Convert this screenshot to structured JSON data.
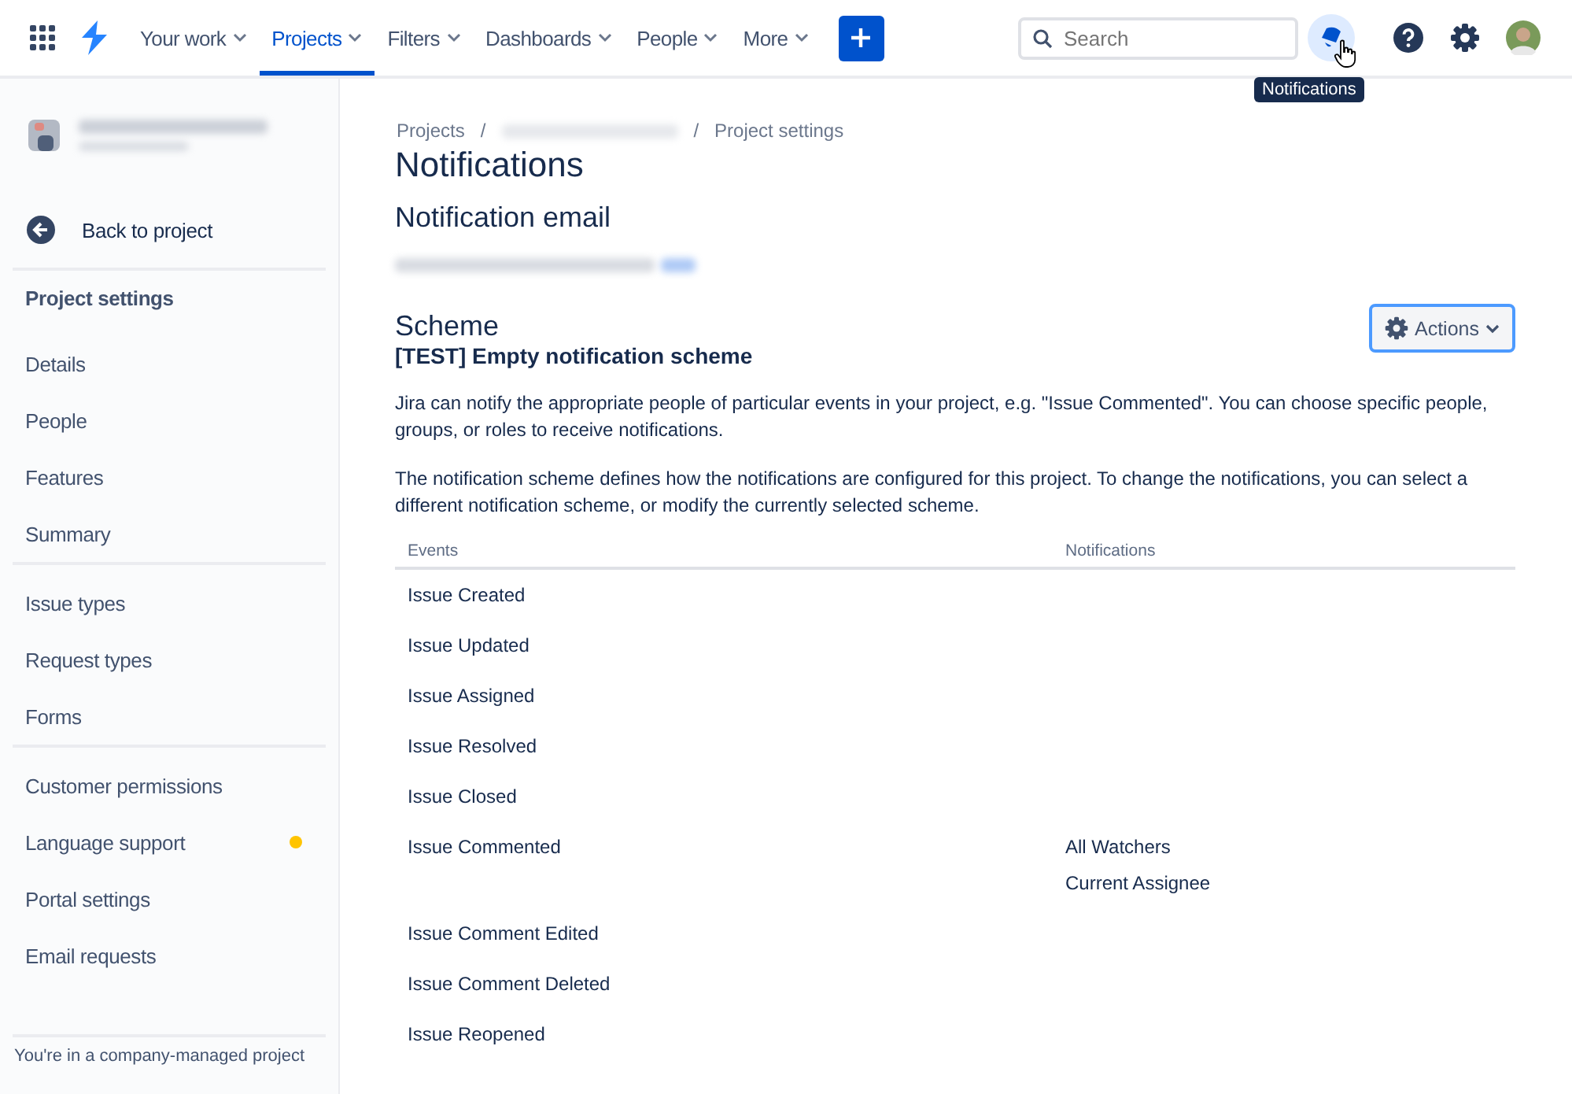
{
  "topbar": {
    "nav": [
      {
        "label": "Your work",
        "selected": false
      },
      {
        "label": "Projects",
        "selected": true
      },
      {
        "label": "Filters",
        "selected": false
      },
      {
        "label": "Dashboards",
        "selected": false
      },
      {
        "label": "People",
        "selected": false
      },
      {
        "label": "More",
        "selected": false
      }
    ],
    "search": {
      "placeholder": "Search"
    },
    "tooltip": "Notifications"
  },
  "sidebar": {
    "back": "Back to project",
    "heading": "Project settings",
    "groups": [
      [
        {
          "label": "Details"
        },
        {
          "label": "People"
        },
        {
          "label": "Features"
        },
        {
          "label": "Summary"
        }
      ],
      [
        {
          "label": "Issue types"
        },
        {
          "label": "Request types"
        },
        {
          "label": "Forms"
        }
      ],
      [
        {
          "label": "Customer permissions"
        },
        {
          "label": "Language support",
          "color": "#ffc400"
        },
        {
          "label": "Portal settings"
        },
        {
          "label": "Email requests"
        }
      ]
    ],
    "footer": "You're in a company-managed project"
  },
  "breadcrumbs": {
    "items": [
      "Projects",
      "Project settings"
    ],
    "separators": [
      "/",
      "/"
    ]
  },
  "title": "Notifications",
  "email_heading": "Notification email",
  "scheme_heading": "Scheme",
  "actions_button": "Actions",
  "scheme_name": "[TEST] Empty notification scheme",
  "paragraphs": [
    "Jira can notify the appropriate people of particular events in your project, e.g. \"Issue Commented\". You can choose specific people, groups, or roles to receive notifications.",
    "The notification scheme defines how the notifications are configured for this project. To change the notifications, you can select a different notification scheme, or modify the currently selected scheme."
  ],
  "table": {
    "columns": [
      "Events",
      "Notifications"
    ],
    "rows": [
      {
        "event": "Issue Created",
        "notifications": []
      },
      {
        "event": "Issue Updated",
        "notifications": []
      },
      {
        "event": "Issue Assigned",
        "notifications": []
      },
      {
        "event": "Issue Resolved",
        "notifications": []
      },
      {
        "event": "Issue Closed",
        "notifications": []
      },
      {
        "event": "Issue Commented",
        "notifications": [
          "All Watchers",
          "Current Assignee"
        ]
      },
      {
        "event": "Issue Comment Edited",
        "notifications": []
      },
      {
        "event": "Issue Comment Deleted",
        "notifications": []
      },
      {
        "event": "Issue Reopened",
        "notifications": []
      }
    ]
  }
}
